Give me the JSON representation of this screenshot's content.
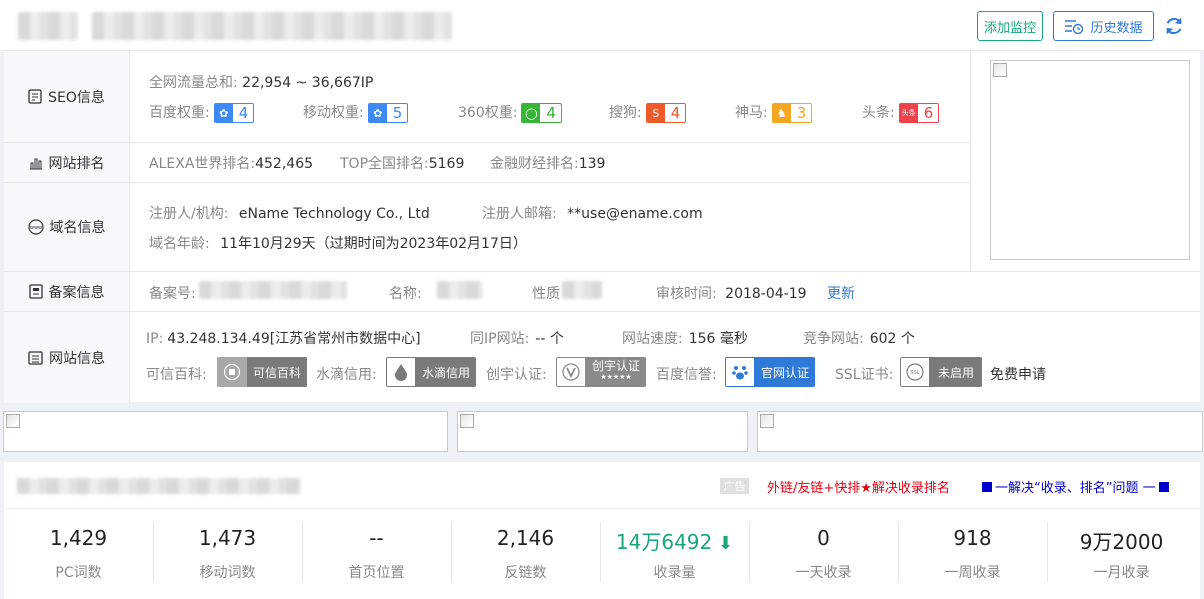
{
  "toolbar": {
    "add_monitor": "添加监控",
    "history": "历史数据"
  },
  "seo": {
    "label": "SEO信息",
    "traffic_label": "全网流量总和:",
    "traffic_value": "22,954 ~ 36,667IP",
    "baidu_label": "百度权重:",
    "baidu_value": "4",
    "mobile_label": "移动权重:",
    "mobile_value": "5",
    "w360_label": "360权重:",
    "w360_value": "4",
    "sogou_label": "搜狗:",
    "sogou_value": "4",
    "shenma_label": "神马:",
    "shenma_value": "3",
    "toutiao_label": "头条:",
    "toutiao_value": "6",
    "colors": {
      "baidu": "#3d8af7",
      "w360": "#36b536",
      "sogou": "#ef5a2a",
      "shenma": "#f5a623",
      "toutiao": "#f0424b"
    }
  },
  "rank": {
    "label": "网站排名",
    "alexa_label": "ALEXA世界排名:",
    "alexa_value": "452,465",
    "top_label": "TOP全国排名:",
    "top_value": "5169",
    "fin_label": "金融财经排名:",
    "fin_value": "139"
  },
  "domain": {
    "label": "域名信息",
    "registrant_label": "注册人/机构:",
    "registrant_value": "eName Technology Co., Ltd",
    "email_label": "注册人邮箱:",
    "email_value": "**use@ename.com",
    "age_label": "域名年龄:",
    "age_value": "11年10月29天（过期时间为2023年02月17日）"
  },
  "beian": {
    "label": "备案信息",
    "number_label": "备案号:",
    "name_label": "名称:",
    "nature_label": "性质",
    "review_label": "审核时间:",
    "review_value": "2018-04-19",
    "update_link": "更新"
  },
  "site": {
    "label": "网站信息",
    "ip_label": "IP:",
    "ip_value": "43.248.134.49[江苏省常州市数据中心]",
    "sameip_label": "同IP网站:",
    "sameip_value": "-- 个",
    "speed_label": "网站速度:",
    "speed_value": "156 毫秒",
    "compete_label": "竞争网站:",
    "compete_value": "602 个",
    "kexin_label": "可信百科:",
    "kexin_btn": "可信百科",
    "shuidi_label": "水滴信用:",
    "shuidi_btn": "水滴信用",
    "chuangyu_label": "创宇认证:",
    "chuangyu_btn": "创宇认证",
    "chuangyu_stars": "★★★★★",
    "baidu_xy_label": "百度信誉:",
    "baidu_xy_btn": "官网认证",
    "ssl_label": "SSL证书:",
    "ssl_btn": "未启用",
    "ssl_apply": "免费申请"
  },
  "ads": {
    "tag": "广告",
    "red_text": "外链/友链+快排★解决收录排名",
    "blue_text": "一解决“收录、排名”问题 一"
  },
  "stats": [
    {
      "value": "1,429",
      "label": "PC词数"
    },
    {
      "value": "1,473",
      "label": "移动词数"
    },
    {
      "value": "--",
      "label": "首页位置"
    },
    {
      "value": "2,146",
      "label": "反链数"
    },
    {
      "value": "14万6492",
      "label": "收录量",
      "trend": "down",
      "color": "#17a77a"
    },
    {
      "value": "0",
      "label": "一天收录"
    },
    {
      "value": "918",
      "label": "一周收录"
    },
    {
      "value": "9万2000",
      "label": "一月收录"
    }
  ]
}
